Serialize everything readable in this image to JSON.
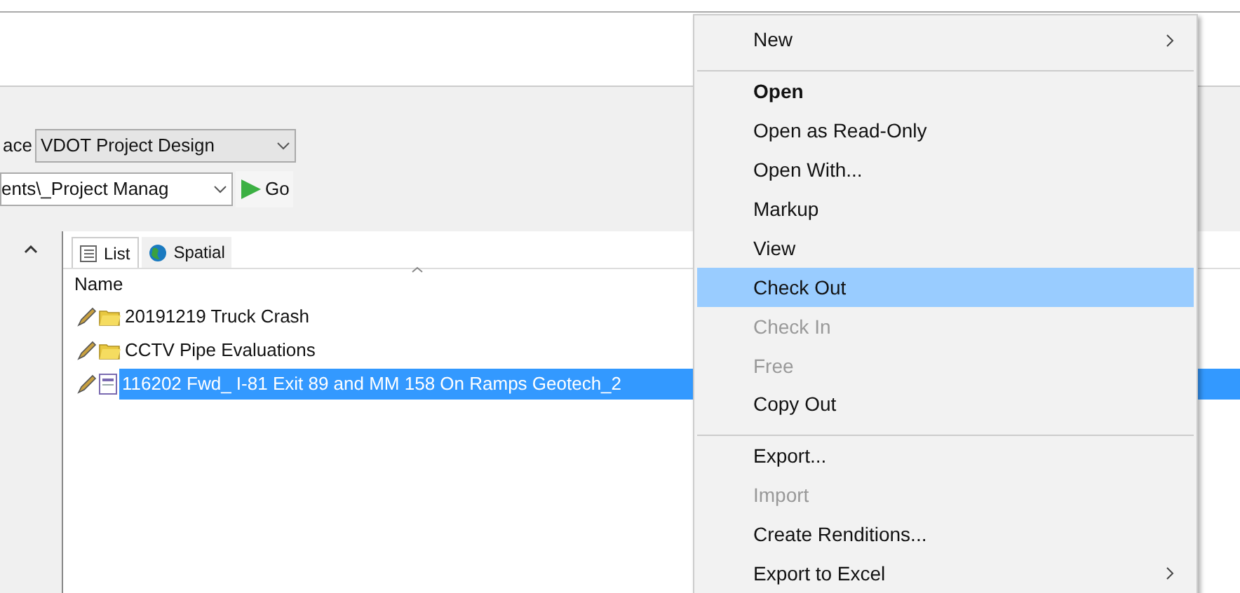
{
  "toolbar": {
    "interface_label": "ace",
    "interface_combo": "VDOT Project Design",
    "path_combo": "ents\\_Project Manag",
    "go_button": "Go"
  },
  "tabs": [
    {
      "label": "List",
      "kind": "list",
      "selected": true
    },
    {
      "label": "Spatial",
      "kind": "globe",
      "selected": false
    }
  ],
  "list": {
    "column": "Name",
    "rows": [
      {
        "name": "20191219 Truck Crash",
        "kind": "folder",
        "selected": false
      },
      {
        "name": "CCTV Pipe Evaluations",
        "kind": "folder",
        "selected": false
      },
      {
        "name": "116202 Fwd_ I-81 Exit 89 and MM 158 On Ramps Geotech_2",
        "kind": "document",
        "selected": true
      }
    ]
  },
  "context_menu": [
    {
      "label": "New",
      "default": false,
      "disabled": false,
      "selected": false,
      "submenu": true,
      "separator_after": true
    },
    {
      "label": "Open",
      "default": true,
      "disabled": false,
      "selected": false,
      "submenu": false,
      "separator_after": false
    },
    {
      "label": "Open as Read-Only",
      "default": false,
      "disabled": false,
      "selected": false,
      "submenu": false,
      "separator_after": false
    },
    {
      "label": "Open With...",
      "default": false,
      "disabled": false,
      "selected": false,
      "submenu": false,
      "separator_after": false
    },
    {
      "label": "Markup",
      "default": false,
      "disabled": false,
      "selected": false,
      "submenu": false,
      "separator_after": false
    },
    {
      "label": "View",
      "default": false,
      "disabled": false,
      "selected": false,
      "submenu": false,
      "separator_after": false
    },
    {
      "label": "Check Out",
      "default": false,
      "disabled": false,
      "selected": true,
      "submenu": false,
      "separator_after": false
    },
    {
      "label": "Check In",
      "default": false,
      "disabled": true,
      "selected": false,
      "submenu": false,
      "separator_after": false
    },
    {
      "label": "Free",
      "default": false,
      "disabled": true,
      "selected": false,
      "submenu": false,
      "separator_after": false
    },
    {
      "label": "Copy Out",
      "default": false,
      "disabled": false,
      "selected": false,
      "submenu": false,
      "separator_after": true
    },
    {
      "label": "Export...",
      "default": false,
      "disabled": false,
      "selected": false,
      "submenu": false,
      "separator_after": false
    },
    {
      "label": "Import",
      "default": false,
      "disabled": true,
      "selected": false,
      "submenu": false,
      "separator_after": false
    },
    {
      "label": "Create Renditions...",
      "default": false,
      "disabled": false,
      "selected": false,
      "submenu": false,
      "separator_after": false
    },
    {
      "label": "Export to Excel",
      "default": false,
      "disabled": false,
      "selected": false,
      "submenu": true,
      "separator_after": false
    }
  ]
}
